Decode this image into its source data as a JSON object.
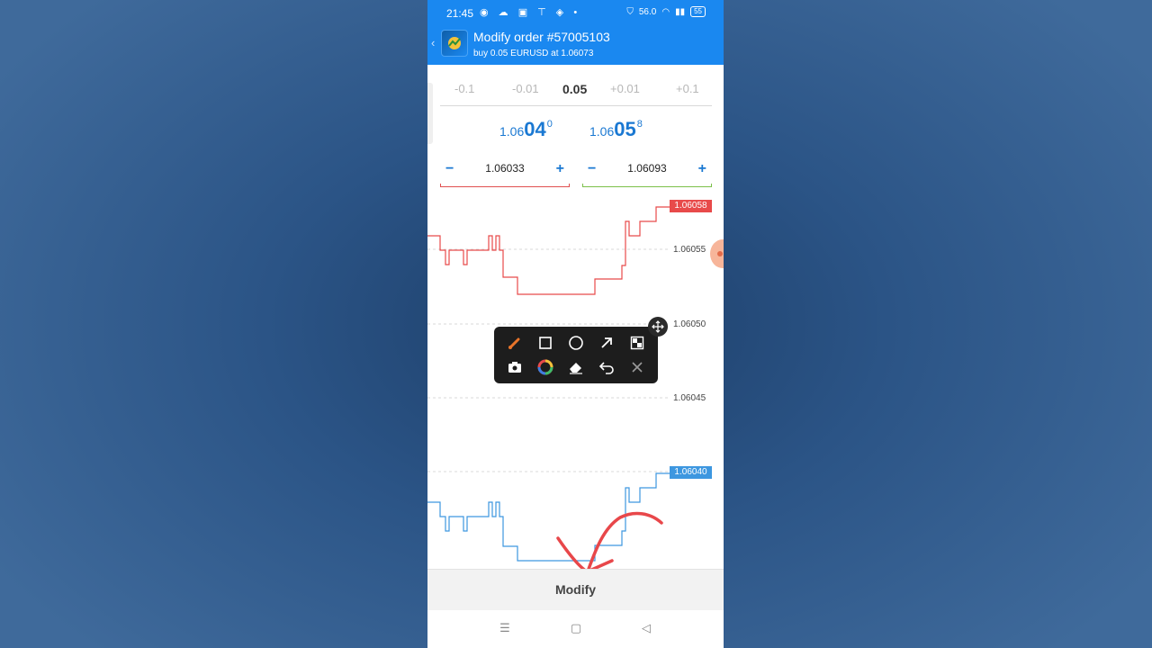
{
  "status_bar": {
    "time": "21:45",
    "left_icons": "◉ ☁ ▣ ⊤ ◈ •",
    "net_speed": "56.0",
    "battery": "55"
  },
  "header": {
    "title": "Modify order #57005103",
    "subtitle": "buy 0.05 EURUSD at 1.06073",
    "back_icon": "‹"
  },
  "volume": {
    "options": [
      "-0.1",
      "-0.01",
      "0.05",
      "+0.01",
      "+0.1"
    ],
    "current": "0.05"
  },
  "prices": {
    "bid": {
      "prefix": "1.06",
      "big": "04",
      "sup": "0"
    },
    "ask": {
      "prefix": "1.06",
      "big": "05",
      "sup": "8"
    }
  },
  "stop_loss": {
    "minus": "−",
    "value": "1.06033",
    "plus": "+",
    "color": "#e05050"
  },
  "take_profit": {
    "minus": "−",
    "value": "1.06093",
    "plus": "+",
    "color": "#7cc04a"
  },
  "chart": {
    "axis_labels": [
      "1.06055",
      "1.06050",
      "1.06045"
    ],
    "ask_tag": "1.06058",
    "bid_tag": "1.06040",
    "ask_color": "#e84a4a",
    "bid_color": "#3d97e0"
  },
  "draw_toolbar": {
    "tools": [
      "brush-icon",
      "rectangle-icon",
      "circle-icon",
      "arrow-icon",
      "mosaic-icon",
      "camera-icon",
      "color-wheel-icon",
      "eraser-icon",
      "undo-icon",
      "close-icon"
    ]
  },
  "modify_label": "Modify",
  "nav": {
    "menu": "☰",
    "home": "▢",
    "back": "◁"
  }
}
